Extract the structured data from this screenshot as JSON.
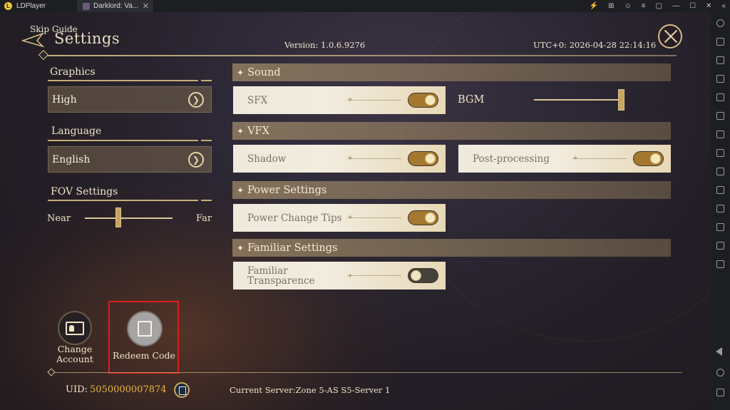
{
  "emulator": {
    "app_name": "LDPlayer",
    "tab_title": "Darklord: Va...",
    "tab_close": "✕",
    "controls": [
      "⚡",
      "⊞",
      "☺",
      "≡",
      "▢",
      "—",
      "☐",
      "✕",
      "«"
    ]
  },
  "header": {
    "skip_guide": "Skip Guide",
    "title": "Settings",
    "version": "Version: 1.0.6.9276",
    "utc": "UTC+0:  2026-04-28 22:14:16"
  },
  "left": {
    "graphics": {
      "label": "Graphics",
      "value": "High"
    },
    "language": {
      "label": "Language",
      "value": "English"
    },
    "fov": {
      "label": "FOV Settings",
      "near": "Near",
      "far": "Far",
      "level": 0.38
    }
  },
  "sections": {
    "sound": {
      "title": "Sound",
      "sfx": {
        "label": "SFX",
        "on": true
      },
      "bgm": {
        "label": "BGM",
        "level": 1.0
      }
    },
    "vfx": {
      "title": "VFX",
      "shadow": {
        "label": "Shadow",
        "on": true
      },
      "post": {
        "label": "Post-processing",
        "on": true
      }
    },
    "power": {
      "title": "Power Settings",
      "tips": {
        "label": "Power Change Tips",
        "on": true
      }
    },
    "familiar": {
      "title": "Familiar Settings",
      "transparence": {
        "label_line1": "Familiar",
        "label_line2": "Transparence",
        "on": false
      }
    }
  },
  "bottom": {
    "change_account": {
      "line1": "Change",
      "line2": "Account"
    },
    "redeem_code": "Redeem Code",
    "uid_label": "UID:",
    "uid_value": "5050000007874",
    "server": "Current Server:Zone 5-AS S5-Server 1"
  },
  "colors": {
    "accent_gold": "#d9bf86",
    "uid_gold": "#e7b63f",
    "toggle_on": "#a4782f",
    "highlight_red": "#e21b1b"
  }
}
